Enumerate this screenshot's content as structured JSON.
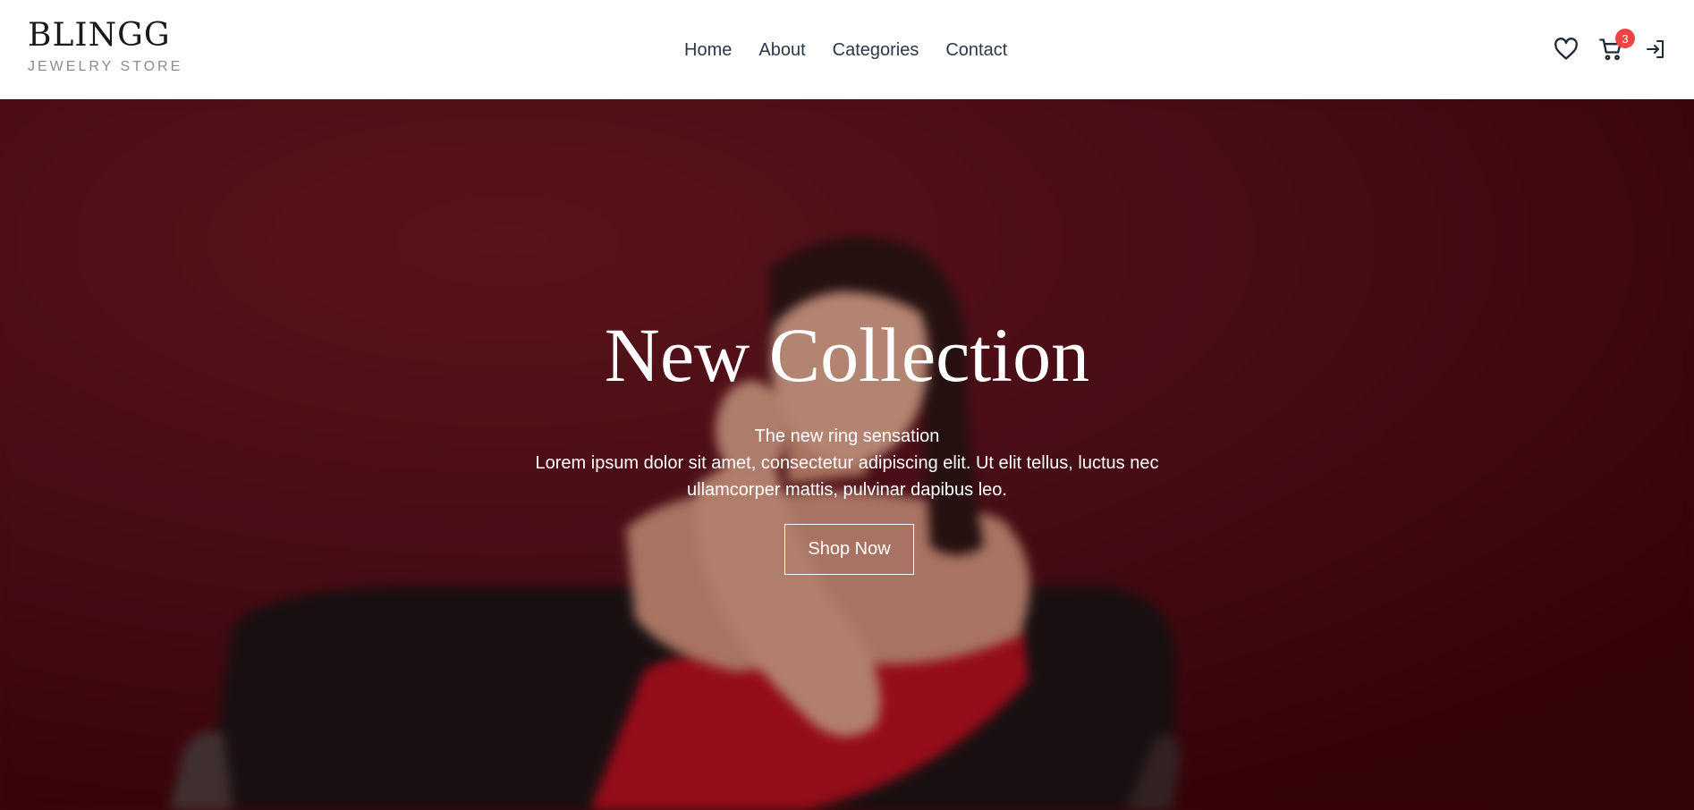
{
  "brand": {
    "name": "BLINGG",
    "subtitle": "JEWELRY STORE"
  },
  "nav": {
    "items": [
      "Home",
      "About",
      "Categories",
      "Contact"
    ]
  },
  "header_icons": {
    "wishlist": "heart-icon",
    "cart": "cart-icon",
    "cart_count": "3",
    "login": "login-icon",
    "badge_color": "#ef4444"
  },
  "hero": {
    "title": "New Collection",
    "tagline": "The new ring sensation",
    "description": "Lorem ipsum dolor sit amet, consectetur adipiscing elit. Ut elit tellus, luctus nec ullamcorper mattis, pulvinar dapibus leo.",
    "cta_label": "Shop Now",
    "background_color": "#5a1018"
  }
}
